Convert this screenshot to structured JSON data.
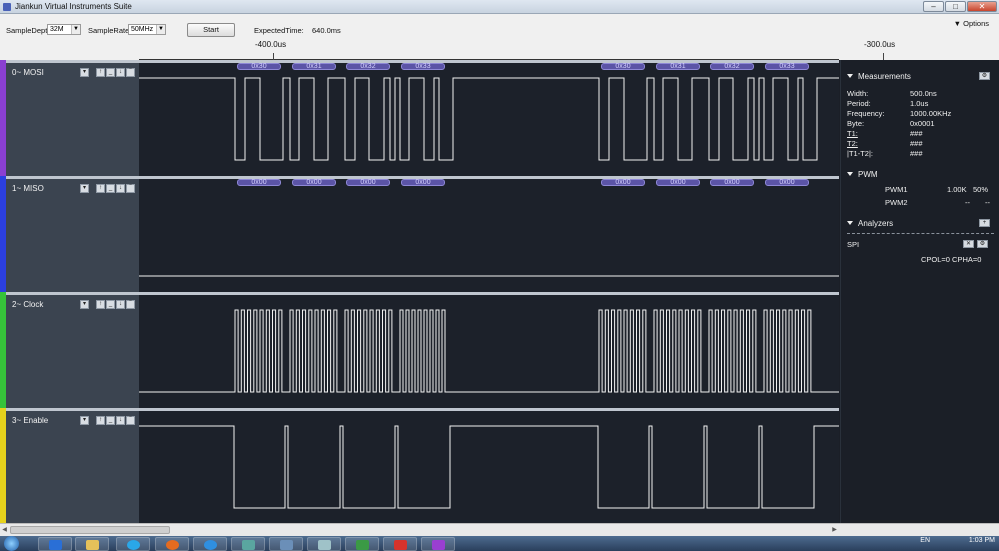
{
  "window": {
    "title": "Jiankun Virtual Instruments Suite",
    "minimize": "–",
    "maximize": "□",
    "close": "✕"
  },
  "toolbar": {
    "sample_depth_label": "SampleDepth",
    "sample_depth_value": "32M",
    "sample_rate_label": "SampleRate",
    "sample_rate_value": "50MHz",
    "start_label": "Start",
    "expected_time_label": "ExpectedTime:",
    "expected_time_value": "640.0ms",
    "options_label": "Options"
  },
  "ruler": {
    "labels": [
      "-400.0us",
      "-300.0us"
    ]
  },
  "channels": [
    {
      "name": "0~ MOSI",
      "color": "#8a3fd1",
      "bus": [
        "0x30",
        "0x31",
        "0x32",
        "0x33",
        "0x30",
        "0x31",
        "0x32",
        "0x33"
      ]
    },
    {
      "name": "1~ MISO",
      "color": "#2b3fe0",
      "bus": [
        "0x00",
        "0x00",
        "0x00",
        "0x00",
        "0x00",
        "0x00",
        "0x00",
        "0x00"
      ]
    },
    {
      "name": "2~ Clock",
      "color": "#36c23a",
      "bus": []
    },
    {
      "name": "3~ Enable",
      "color": "#e6d21c",
      "bus": []
    }
  ],
  "measurements": {
    "title": "Measurements",
    "rows": [
      {
        "label": "Width:",
        "value": "500.0ns"
      },
      {
        "label": "Period:",
        "value": "1.0us"
      },
      {
        "label": "Frequency:",
        "value": "1000.00KHz"
      },
      {
        "label": "Byte:",
        "value": "0x0001"
      },
      {
        "label": "T1:",
        "value": "###"
      },
      {
        "label": "T2:",
        "value": "###"
      },
      {
        "label": "|T1-T2|:",
        "value": "###"
      }
    ]
  },
  "pwm": {
    "title": "PWM",
    "rows": [
      {
        "label": "PWM1",
        "freq": "1.00K",
        "duty": "50%"
      },
      {
        "label": "PWM2",
        "freq": "--",
        "duty": "--"
      }
    ]
  },
  "analyzers": {
    "title": "Analyzers",
    "add": "+",
    "name": "SPI",
    "config": "CPOL=0 CPHA=0"
  },
  "taskbar": {
    "lang": "EN",
    "time": "1:03 PM"
  }
}
